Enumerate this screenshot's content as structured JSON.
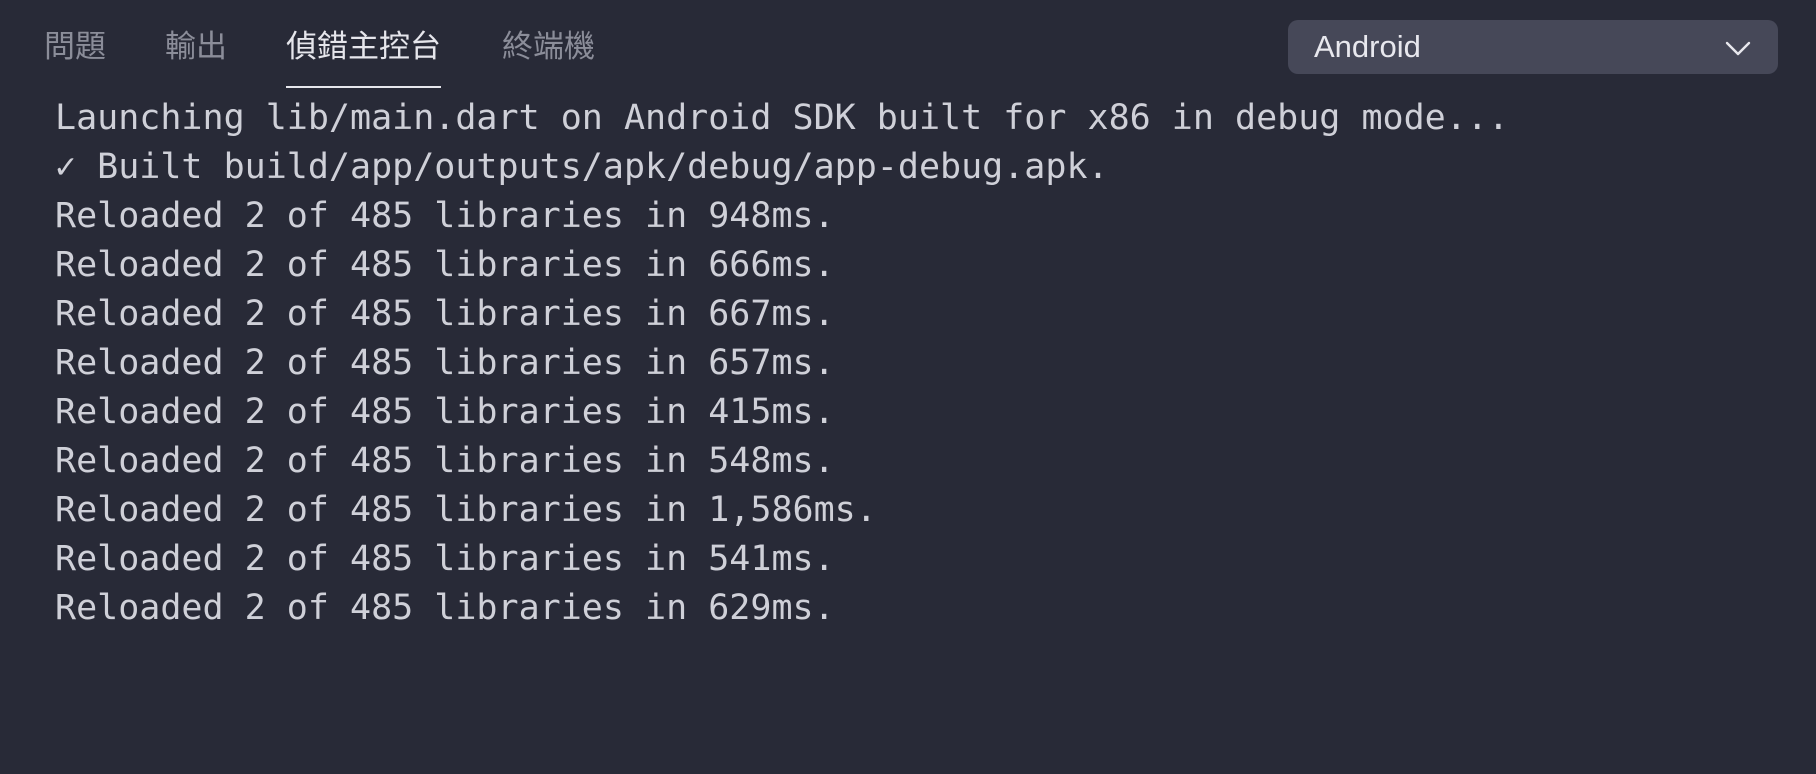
{
  "tabs": [
    {
      "label": "問題",
      "active": false
    },
    {
      "label": "輸出",
      "active": false
    },
    {
      "label": "偵錯主控台",
      "active": true
    },
    {
      "label": "終端機",
      "active": false
    }
  ],
  "device_select": {
    "value": "Android",
    "icon": "chevron-down-icon"
  },
  "console_lines": [
    "Launching lib/main.dart on Android SDK built for x86 in debug mode...",
    "✓ Built build/app/outputs/apk/debug/app-debug.apk.",
    "Reloaded 2 of 485 libraries in 948ms.",
    "Reloaded 2 of 485 libraries in 666ms.",
    "Reloaded 2 of 485 libraries in 667ms.",
    "Reloaded 2 of 485 libraries in 657ms.",
    "Reloaded 2 of 485 libraries in 415ms.",
    "Reloaded 2 of 485 libraries in 548ms.",
    "Reloaded 2 of 485 libraries in 1,586ms.",
    "Reloaded 2 of 485 libraries in 541ms.",
    "Reloaded 2 of 485 libraries in 629ms."
  ],
  "colors": {
    "background": "#282a37",
    "text": "#cfd0d8",
    "tab_inactive": "#8b8d99",
    "tab_active": "#e6e6ec",
    "select_background": "#464858"
  }
}
